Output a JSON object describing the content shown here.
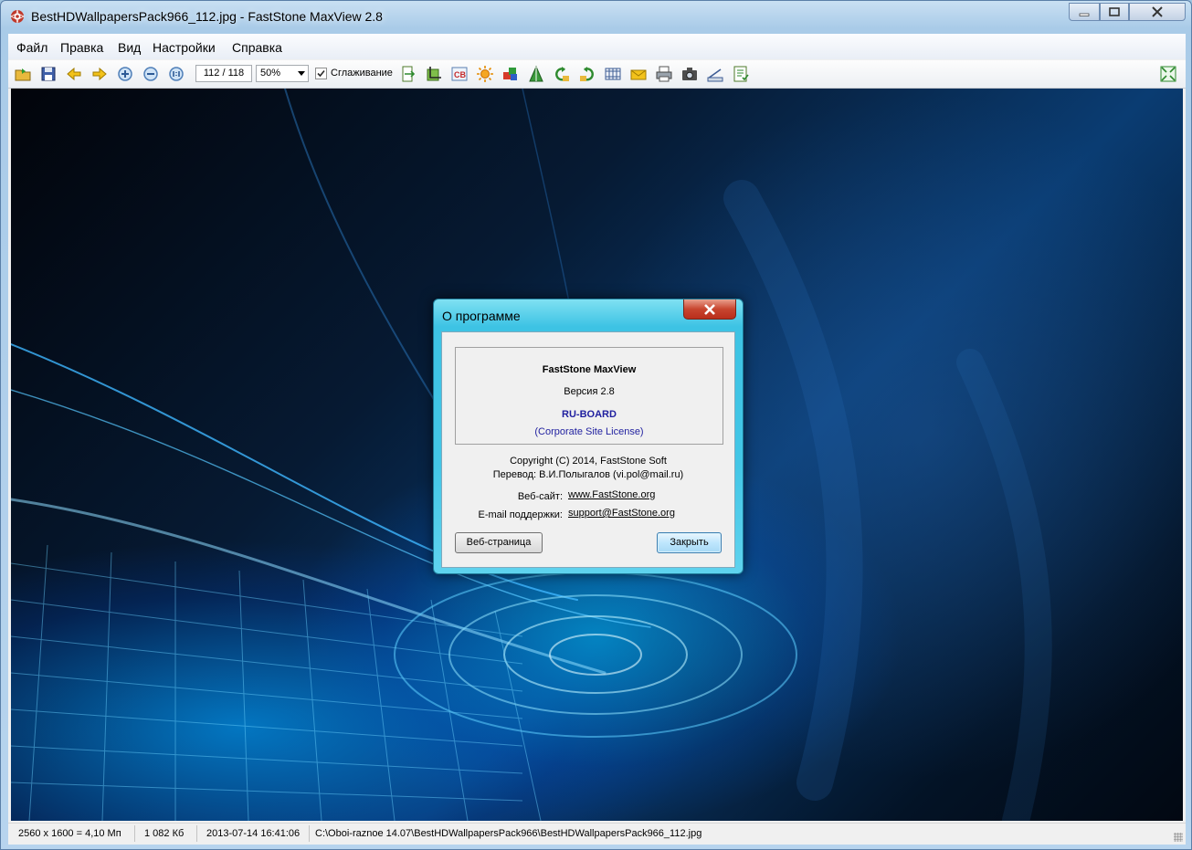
{
  "window": {
    "title": "BestHDWallpapersPack966_112.jpg - FastStone MaxView 2.8"
  },
  "menu": {
    "items": [
      "Файл",
      "Правка",
      "Вид",
      "Настройки",
      "Справка"
    ]
  },
  "toolbar": {
    "icons": [
      "open-folder-icon",
      "save-icon",
      "prev-arrow-icon",
      "next-arrow-icon",
      "zoom-in-icon",
      "zoom-out-icon",
      "actual-size-icon",
      "resize-icon",
      "crop-icon",
      "cb-adjust-icon",
      "brightness-icon",
      "colors-icon",
      "sharpen-icon",
      "rotate-left-icon",
      "rotate-right-icon",
      "filmstrip-icon",
      "email-icon",
      "print-icon",
      "screenshot-icon",
      "scanner-icon",
      "settings-list-icon",
      "fullscreen-icon"
    ],
    "page_counter": "112 / 118",
    "zoom_value": "50%",
    "smoothing_label": "Сглаживание",
    "smoothing_checked": true
  },
  "status": {
    "dimensions": "2560 x 1600 = 4,10 Мп",
    "filesize": "1 082 Кб",
    "datetime": "2013-07-14 16:41:06",
    "path": "C:\\Oboi-raznoe 14.07\\BestHDWallpapersPack966\\BestHDWallpapersPack966_112.jpg"
  },
  "dialog": {
    "title": "О программе",
    "product": "FastStone MaxView",
    "version": "Версия 2.8",
    "registered_to": "RU-BOARD",
    "license": "(Corporate Site License)",
    "copyright": "Copyright (C) 2014, FastStone Soft",
    "translator": "Перевод: В.И.Полыгалов (vi.pol@mail.ru)",
    "website_label": "Веб-сайт:",
    "website_link": "www.FastStone.org",
    "email_label": "E-mail поддержки:",
    "email_link": "support@FastStone.org",
    "web_button": "Веб-страница",
    "close_button": "Закрыть"
  },
  "colors": {
    "accent_cyan": "#43c6e6",
    "link_blue": "#1f1f9f",
    "close_red": "#c8452f"
  }
}
